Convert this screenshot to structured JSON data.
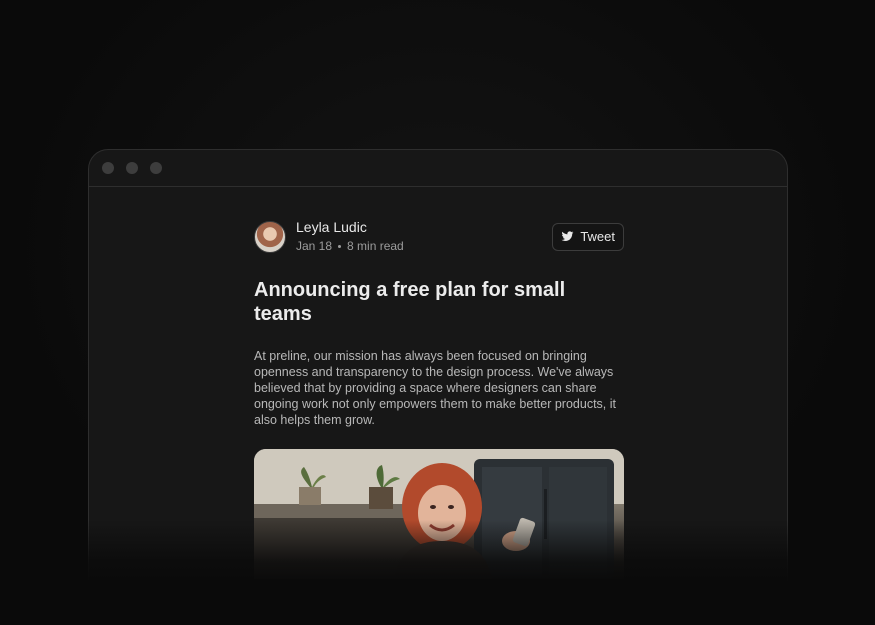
{
  "window": {
    "controls": [
      "close-dot",
      "minimize-dot",
      "maximize-dot"
    ]
  },
  "post": {
    "author": {
      "name": "Leyla Ludic",
      "date": "Jan 18",
      "read_time": "8 min read"
    },
    "tweet_button": {
      "label": "Tweet",
      "icon": "twitter-icon"
    },
    "title": "Announcing a free plan for small teams",
    "body": "At preline, our mission has always been focused on bringing openness and transparency to the design process. We've always believed that by providing a space where designers can share ongoing work not only empowers them to make better products, it also helps them grow.",
    "image": {
      "icon": "hero-photo"
    }
  },
  "colors": {
    "background": "#0a0a0a",
    "window": "#171717",
    "border": "#2e2e2e",
    "text_primary": "#ececec",
    "text_secondary": "#9c9c9c"
  }
}
